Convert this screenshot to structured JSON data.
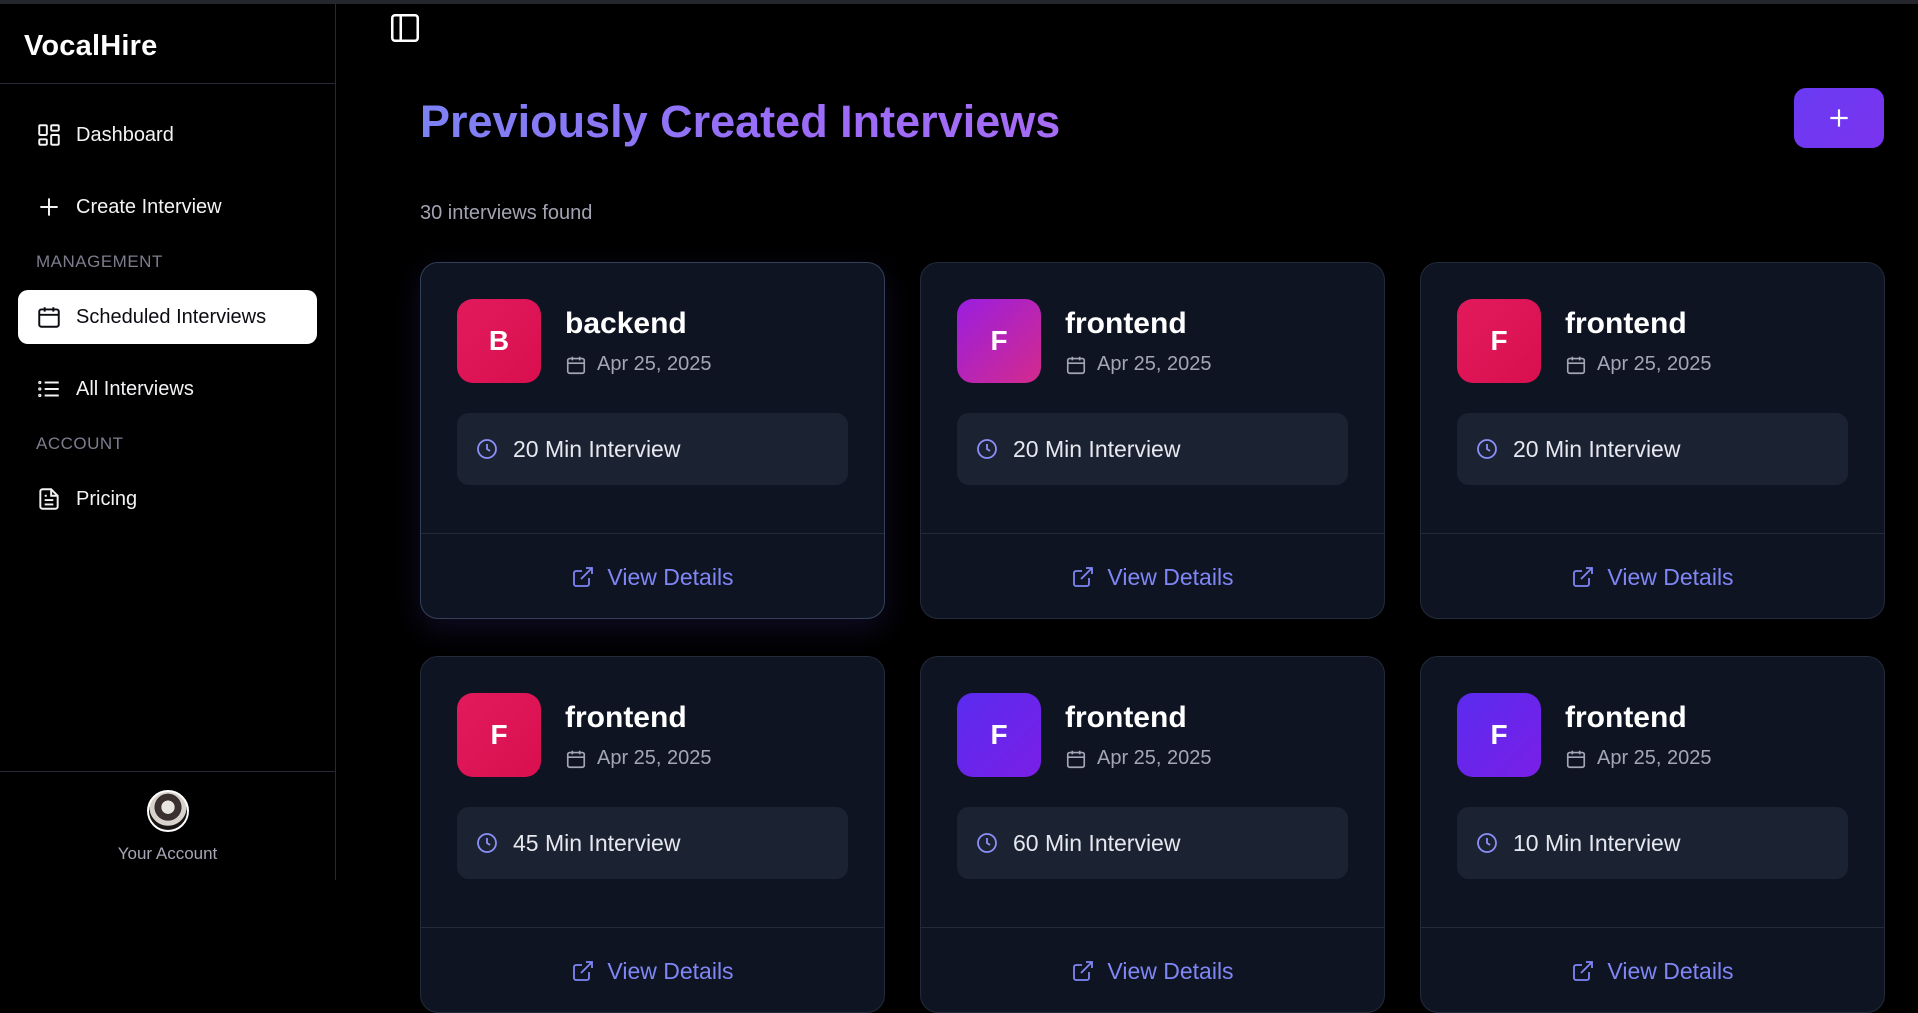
{
  "app": {
    "brand": "VocalHire"
  },
  "sidebar": {
    "nav": [
      {
        "label": "Dashboard",
        "icon": "grid-icon"
      },
      {
        "label": "Create Interview",
        "icon": "plus-icon"
      }
    ],
    "sections": [
      {
        "label": "MANAGEMENT",
        "items": [
          {
            "label": "Scheduled Interviews",
            "icon": "calendar-icon",
            "active": true
          },
          {
            "label": "All Interviews",
            "icon": "list-icon"
          }
        ]
      },
      {
        "label": "ACCOUNT",
        "items": [
          {
            "label": "Pricing",
            "icon": "document-icon"
          }
        ]
      }
    ],
    "footer": {
      "label": "Your Account"
    }
  },
  "main": {
    "title": "Previously Created Interviews",
    "count_text": "30 interviews found",
    "view_label": "View Details",
    "cards": [
      {
        "initial": "B",
        "title": "backend",
        "date": "Apr 25, 2025",
        "duration": "20 Min Interview",
        "badge_gradient": [
          "#e21a5c",
          "#d90f4f"
        ]
      },
      {
        "initial": "F",
        "title": "frontend",
        "date": "Apr 25, 2025",
        "duration": "20 Min Interview",
        "badge_gradient": [
          "#9a1ee0",
          "#d42a8c"
        ]
      },
      {
        "initial": "F",
        "title": "frontend",
        "date": "Apr 25, 2025",
        "duration": "20 Min Interview",
        "badge_gradient": [
          "#e21a5c",
          "#d90f4f"
        ]
      },
      {
        "initial": "F",
        "title": "frontend",
        "date": "Apr 25, 2025",
        "duration": "45 Min Interview",
        "badge_gradient": [
          "#e21a5c",
          "#d90f4f"
        ]
      },
      {
        "initial": "F",
        "title": "frontend",
        "date": "Apr 25, 2025",
        "duration": "60 Min Interview",
        "badge_gradient": [
          "#5a2bef",
          "#7a1fe6"
        ]
      },
      {
        "initial": "F",
        "title": "frontend",
        "date": "Apr 25, 2025",
        "duration": "10 Min Interview",
        "badge_gradient": [
          "#5a2bef",
          "#7a1fe6"
        ]
      }
    ]
  },
  "colors": {
    "accent": "#6a3af2",
    "link": "#7f86f6",
    "card_bg": "#0f1422",
    "chip_bg": "#1b2333"
  }
}
